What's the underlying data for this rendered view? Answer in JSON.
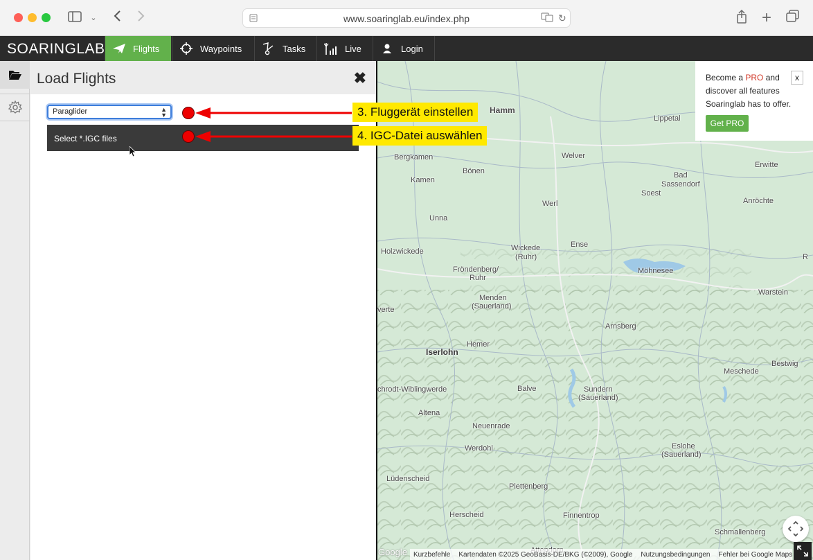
{
  "browser": {
    "url": "www.soaringlab.eu/index.php"
  },
  "app": {
    "brand": "SOARINGLAB",
    "nav": [
      {
        "label": "Flights",
        "icon": "plane-icon",
        "active": true
      },
      {
        "label": "Waypoints",
        "icon": "crosshair-icon",
        "active": false
      },
      {
        "label": "Tasks",
        "icon": "tasks-icon",
        "active": false
      },
      {
        "label": "Live",
        "icon": "signal-icon",
        "active": false
      },
      {
        "label": "Login",
        "icon": "user-icon",
        "active": false
      }
    ],
    "accent_color": "#62b14b"
  },
  "panel": {
    "title": "Load Flights",
    "aircraft_select": {
      "value": "Paraglider"
    },
    "file_button_label": "Select *.IGC files"
  },
  "annotations": [
    {
      "label": "3. Fluggerät einstellen"
    },
    {
      "label": "4. IGC-Datei auswählen"
    }
  ],
  "promo": {
    "text_before": "Become a ",
    "text_pro": "PRO",
    "text_after": " and discover all features Soaringlab has to offer.",
    "close_label": "x",
    "button_label": "Get PRO"
  },
  "map": {
    "towns": [
      {
        "name": "Hamm"
      },
      {
        "name": "Lippetal"
      },
      {
        "name": "Bergkamen"
      },
      {
        "name": "Welver"
      },
      {
        "name": "Erwitte"
      },
      {
        "name": "Bönen"
      },
      {
        "name": "Bad"
      },
      {
        "name": "Sassendorf"
      },
      {
        "name": "Kamen"
      },
      {
        "name": "Soest"
      },
      {
        "name": "Werl"
      },
      {
        "name": "Anröchte"
      },
      {
        "name": "Unna"
      },
      {
        "name": "Wickede"
      },
      {
        "name": "(Ruhr)"
      },
      {
        "name": "Ense"
      },
      {
        "name": "Holzwickede"
      },
      {
        "name": "Fröndenberg/"
      },
      {
        "name": "Ruhr"
      },
      {
        "name": "Möhnesee"
      },
      {
        "name": "Warstein"
      },
      {
        "name": "Menden"
      },
      {
        "name": "(Sauerland)"
      },
      {
        "name": "verte"
      },
      {
        "name": "Arnsberg"
      },
      {
        "name": "Hemer"
      },
      {
        "name": "Iserlohn"
      },
      {
        "name": "Bestwig"
      },
      {
        "name": "Meschede"
      },
      {
        "name": "Balve"
      },
      {
        "name": "Sundern"
      },
      {
        "name": "(Sauerland)"
      },
      {
        "name": "chrodt-Wiblingwerde"
      },
      {
        "name": "Altena"
      },
      {
        "name": "Neuenrade"
      },
      {
        "name": "Werdohl"
      },
      {
        "name": "Eslohe"
      },
      {
        "name": "(Sauerland)"
      },
      {
        "name": "Lüdenscheid"
      },
      {
        "name": "Plettenberg"
      },
      {
        "name": "Herscheid"
      },
      {
        "name": "Finnentrop"
      },
      {
        "name": "Schmallenberg"
      },
      {
        "name": "Attendorn"
      },
      {
        "name": "R"
      }
    ],
    "attribution": [
      "Kurzbefehle",
      "Kartendaten ©2025 GeoBasis-DE/BKG (©2009), Google",
      "Nutzungsbedingungen",
      "Fehler bei Google Maps m"
    ],
    "logo_text": "Google"
  }
}
